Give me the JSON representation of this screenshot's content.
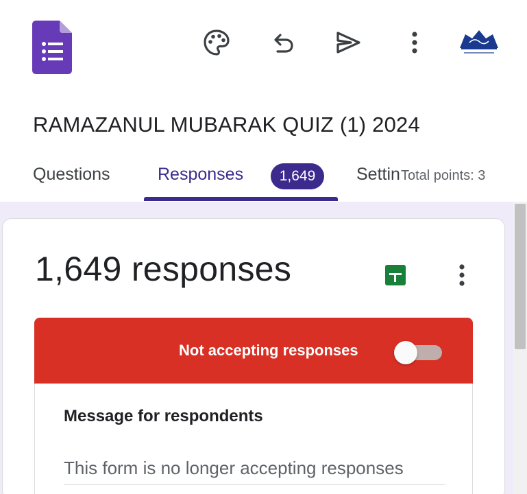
{
  "header": {
    "form_title": "RAMAZANUL MUBARAK QUIZ (1) 2024",
    "app_icon": "google-forms-icon",
    "toolbar": {
      "palette_icon": "palette-icon",
      "undo_icon": "undo-icon",
      "send_icon": "send-icon",
      "more_icon": "more-vert-icon"
    },
    "avatar_icon": "account-avatar-logo"
  },
  "tabs": {
    "questions": "Questions",
    "responses": "Responses",
    "responses_badge": "1,649",
    "settings": "Settings",
    "total_points": "Total points: 3"
  },
  "responses_card": {
    "count_label": "1,649 responses",
    "sheets_icon": "google-sheets-icon",
    "more_icon": "more-vert-icon",
    "accepting_banner": {
      "label": "Not accepting responses",
      "toggle_on": false,
      "color": "#d93025"
    },
    "message": {
      "title": "Message for respondents",
      "value": "This form is no longer accepting responses"
    }
  },
  "colors": {
    "accent": "#3c2a8d",
    "canvas": "#f0ebf8",
    "forms_purple": "#673ab7",
    "sheets_green": "#188038"
  }
}
